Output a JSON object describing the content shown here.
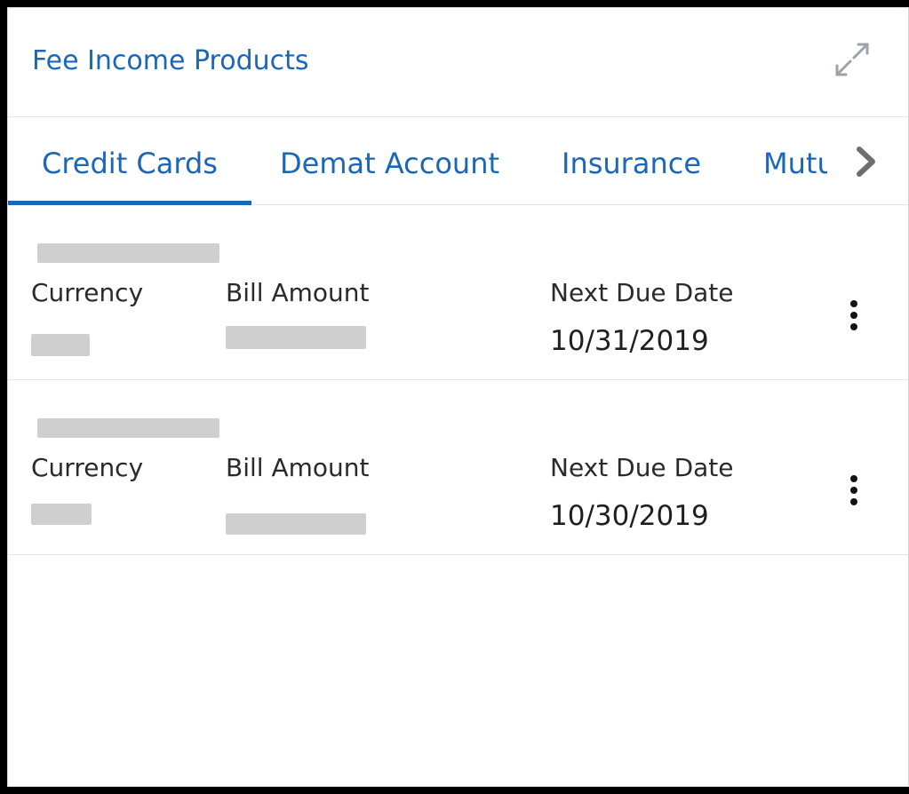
{
  "widget": {
    "title": "Fee Income Products",
    "expand_icon": "expand-arrows-icon",
    "accent_color": "#1a67b8"
  },
  "tabs": [
    {
      "label": "Credit Cards",
      "active": true
    },
    {
      "label": "Demat Account",
      "active": false
    },
    {
      "label": "Insurance",
      "active": false
    },
    {
      "label": "Mutual Funds",
      "active": false
    }
  ],
  "tab_next_icon": "chevron-right-icon",
  "rows": [
    {
      "currency_label": "Currency",
      "bill_amount_label": "Bill Amount",
      "next_due_date_label": "Next Due Date",
      "next_due_date": "10/31/2019",
      "actions_icon": "kebab-menu-icon"
    },
    {
      "currency_label": "Currency",
      "bill_amount_label": "Bill Amount",
      "next_due_date_label": "Next Due Date",
      "next_due_date": "10/30/2019",
      "actions_icon": "kebab-menu-icon"
    }
  ]
}
